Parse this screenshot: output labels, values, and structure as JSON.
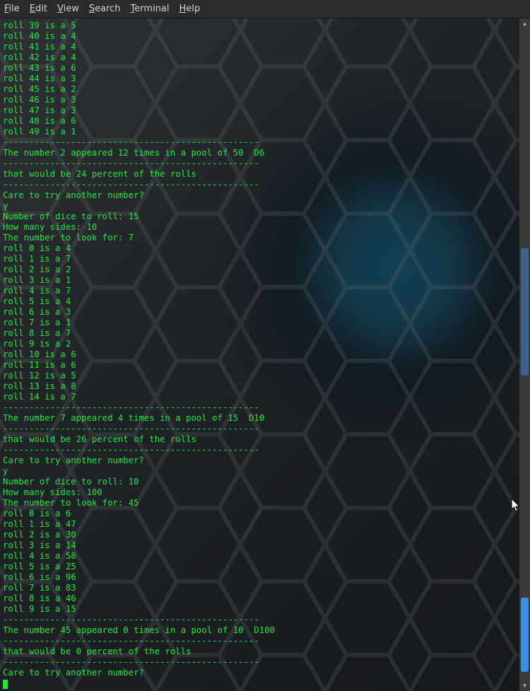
{
  "menubar": {
    "file": "File",
    "edit": "Edit",
    "view": "View",
    "search": "Search",
    "terminal": "Terminal",
    "help": "Help"
  },
  "terminal": {
    "lines": [
      "roll 39 is a 5",
      "roll 40 is a 4",
      "roll 41 is a 4",
      "roll 42 is a 4",
      "roll 43 is a 6",
      "roll 44 is a 3",
      "roll 45 is a 2",
      "roll 46 is a 3",
      "roll 47 is a 3",
      "roll 48 is a 6",
      "roll 49 is a 1",
      "-------------------------------------------------",
      "The number 2 appeared 12 times in a pool of 50  D6",
      "-------------------------------------------------",
      "that would be 24 percent of the rolls",
      "-------------------------------------------------",
      "Care to try another number?",
      "y",
      "Number of dice to roll: 15",
      "How many sides: 10",
      "The number to look for: 7",
      "roll 0 is a 4",
      "roll 1 is a 7",
      "roll 2 is a 2",
      "roll 3 is a 1",
      "roll 4 is a 7",
      "roll 5 is a 4",
      "roll 6 is a 3",
      "roll 7 is a 1",
      "roll 8 is a 7",
      "roll 9 is a 2",
      "roll 10 is a 6",
      "roll 11 is a 6",
      "roll 12 is a 5",
      "roll 13 is a 8",
      "roll 14 is a 7",
      "-------------------------------------------------",
      "The number 7 appeared 4 times in a pool of 15  D10",
      "-------------------------------------------------",
      "that would be 26 percent of the rolls",
      "-------------------------------------------------",
      "Care to try another number?",
      "y",
      "Number of dice to roll: 10",
      "How many sides: 100",
      "The number to look for: 45",
      "roll 0 is a 6",
      "roll 1 is a 47",
      "roll 2 is a 30",
      "roll 3 is a 14",
      "roll 4 is a 58",
      "roll 5 is a 25",
      "roll 6 is a 96",
      "roll 7 is a 83",
      "roll 8 is a 46",
      "roll 9 is a 15",
      "-------------------------------------------------",
      "The number 45 appeared 0 times in a pool of 10  D100",
      "-------------------------------------------------",
      "that would be 0 percent of the rolls",
      "-------------------------------------------------",
      "Care to try another number?"
    ]
  },
  "scrollbar": {
    "up_glyph": "▴",
    "down_glyph": "▾"
  }
}
